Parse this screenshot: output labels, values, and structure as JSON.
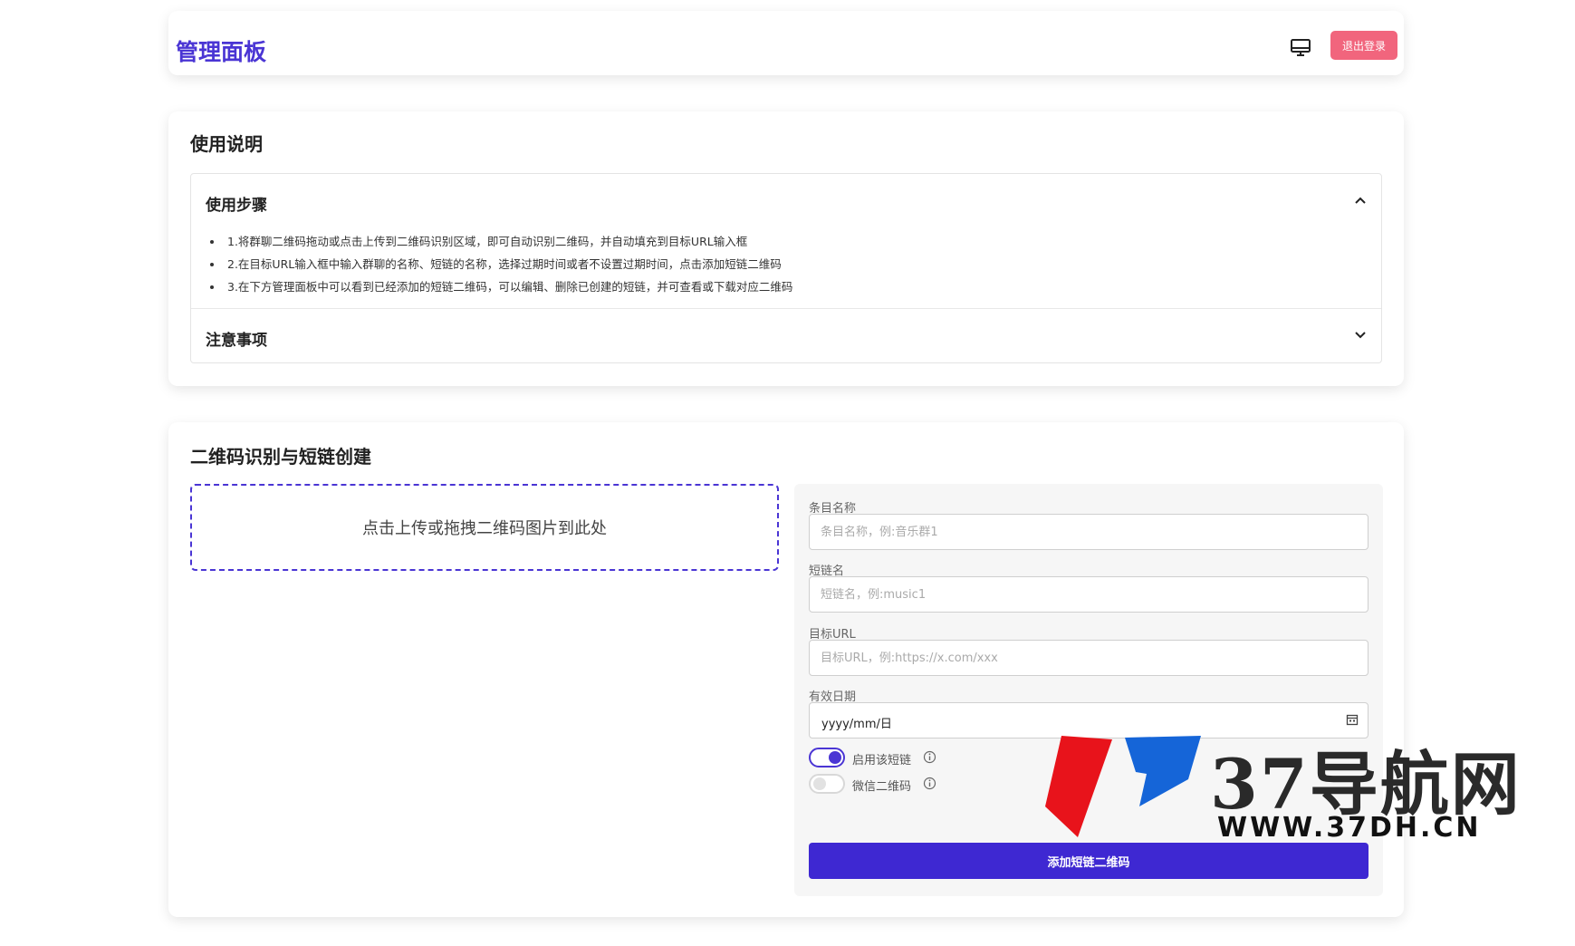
{
  "header": {
    "title": "管理面板",
    "logout_label": "退出登录"
  },
  "instructions": {
    "title": "使用说明",
    "steps_panel": {
      "title": "使用步骤",
      "items": [
        "1.将群聊二维码拖动或点击上传到二维码识别区域，即可自动识别二维码，并自动填充到目标URL输入框",
        "2.在目标URL输入框中输入群聊的名称、短链的名称，选择过期时间或者不设置过期时间，点击添加短链二维码",
        "3.在下方管理面板中可以看到已经添加的短链二维码，可以编辑、删除已创建的短链，并可查看或下载对应二维码"
      ]
    },
    "notes_panel": {
      "title": "注意事项"
    }
  },
  "creator": {
    "title": "二维码识别与短链创建",
    "dropzone_text": "点击上传或拖拽二维码图片到此处",
    "fields": {
      "name": {
        "label": "条目名称",
        "placeholder": "条目名称，例:音乐群1"
      },
      "short": {
        "label": "短链名",
        "placeholder": "短链名，例:music1"
      },
      "url": {
        "label": "目标URL",
        "placeholder": "目标URL，例:https://x.com/xxx"
      },
      "date": {
        "label": "有效日期",
        "value": "yyyy/mm/日"
      }
    },
    "toggles": {
      "enable": {
        "label": "启用该短链",
        "on": true
      },
      "wechat": {
        "label": "微信二维码",
        "on": false
      }
    },
    "submit_label": "添加短链二维码"
  },
  "watermark": {
    "text": "37导航网",
    "url": "WWW.37DH.CN"
  },
  "colors": {
    "accent": "#4a35d4",
    "button": "#3e28d2",
    "logout": "#f1657d"
  }
}
